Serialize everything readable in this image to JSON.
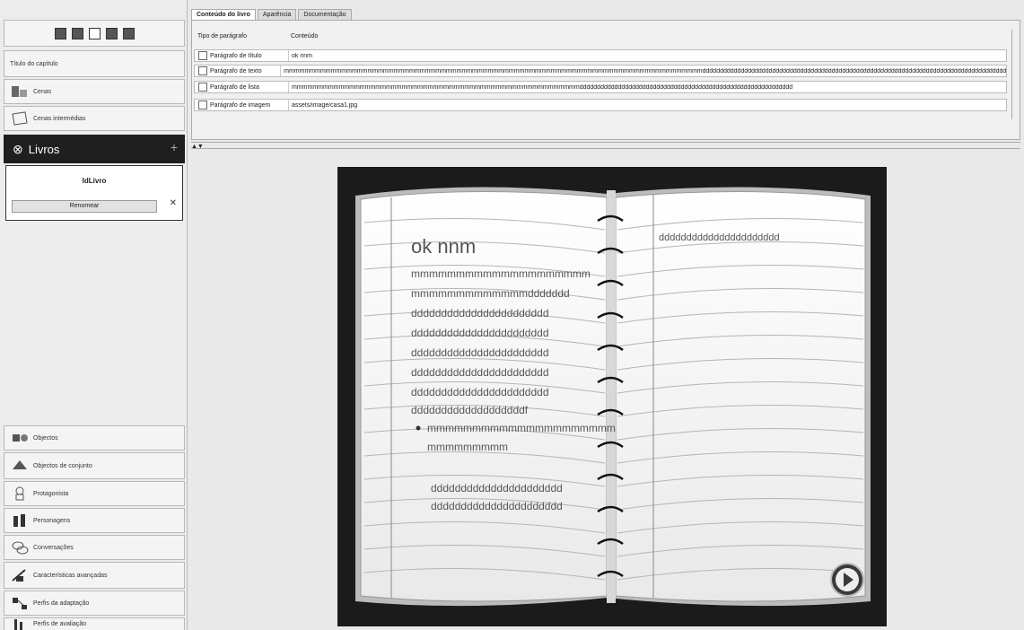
{
  "sidebar": {
    "chapter_title_label": "Título do capítulo",
    "items_top": [
      {
        "label": "Cenas",
        "icon": "scene-icon"
      },
      {
        "label": "Cenas intermédias",
        "icon": "cutscene-icon"
      }
    ],
    "section": {
      "label": "Livros",
      "add": "+"
    },
    "book": {
      "name": "IdLivro",
      "rename_label": "Renomear"
    },
    "items_bottom": [
      {
        "label": "Objectos",
        "icon": "object-icon"
      },
      {
        "label": "Objectos de conjunto",
        "icon": "set-object-icon"
      },
      {
        "label": "Protagonista",
        "icon": "player-icon"
      },
      {
        "label": "Personagens",
        "icon": "characters-icon"
      },
      {
        "label": "Conversações",
        "icon": "conversation-icon"
      },
      {
        "label": "Características avançadas",
        "icon": "advanced-icon"
      },
      {
        "label": "Perfis da adaptação",
        "icon": "adaptation-icon"
      },
      {
        "label": "Perfis de avaliação",
        "icon": "assessment-icon"
      }
    ]
  },
  "tabs": [
    {
      "label": "Conteúdo do livro",
      "active": true
    },
    {
      "label": "Aparência",
      "active": false
    },
    {
      "label": "Documentação",
      "active": false
    }
  ],
  "table": {
    "headers": [
      "Tipo de parágrafo",
      "Conteúdo"
    ],
    "rows": [
      {
        "type": "Parágrafo de título",
        "content": "ok nnm"
      },
      {
        "type": "Parágrafo de texto",
        "content": "mmmmmmmmmmmmmmmmmmmmmmmmmmmmmmmmmmmmmmmmmmmmmmmmmmmmmmmmmmmmmmmmmmmmmmmmmmmmmmmmddddddddddddddddddddddddddddddddddddddddddddddddddddddddddddddddddddddddddddddddddddddddddddddddddddddddddd"
      },
      {
        "type": "Parágrafo de lista",
        "content": "mmmmmmmmmmmmmmmmmmmmmmmmmmmmmmmmmmmmmmmmmmmmmmmmmmmmmmmddddddddddddddddddddddddddddddddddddddddddddddddddddddddddddd"
      },
      {
        "type": "Parágrafo de imagem",
        "content": "assets/image/casa1.jpg"
      }
    ]
  },
  "book_page": {
    "title": "ok nnm",
    "left_lines": [
      "mmmmmmmmmmmmmmmmmmmm",
      "mmmmmmmmmmmmmddddddd",
      "ddddddddddddddddddddddd",
      "ddddddddddddddddddddddd",
      "ddddddddddddddddddddddd",
      "ddddddddddddddddddddddd",
      "ddddddddddddddddddddddd",
      "dddddddddddddddddddf"
    ],
    "bullet_lines": [
      "mmmmmmmmmmmmmmmmmmmmm",
      "mmmmmmmmm"
    ],
    "bottom_lines": [
      "dddddddddddddddddddddd",
      "dddddddddddddddddddddd"
    ],
    "right_line": "dddddddddddddddddddddd"
  }
}
